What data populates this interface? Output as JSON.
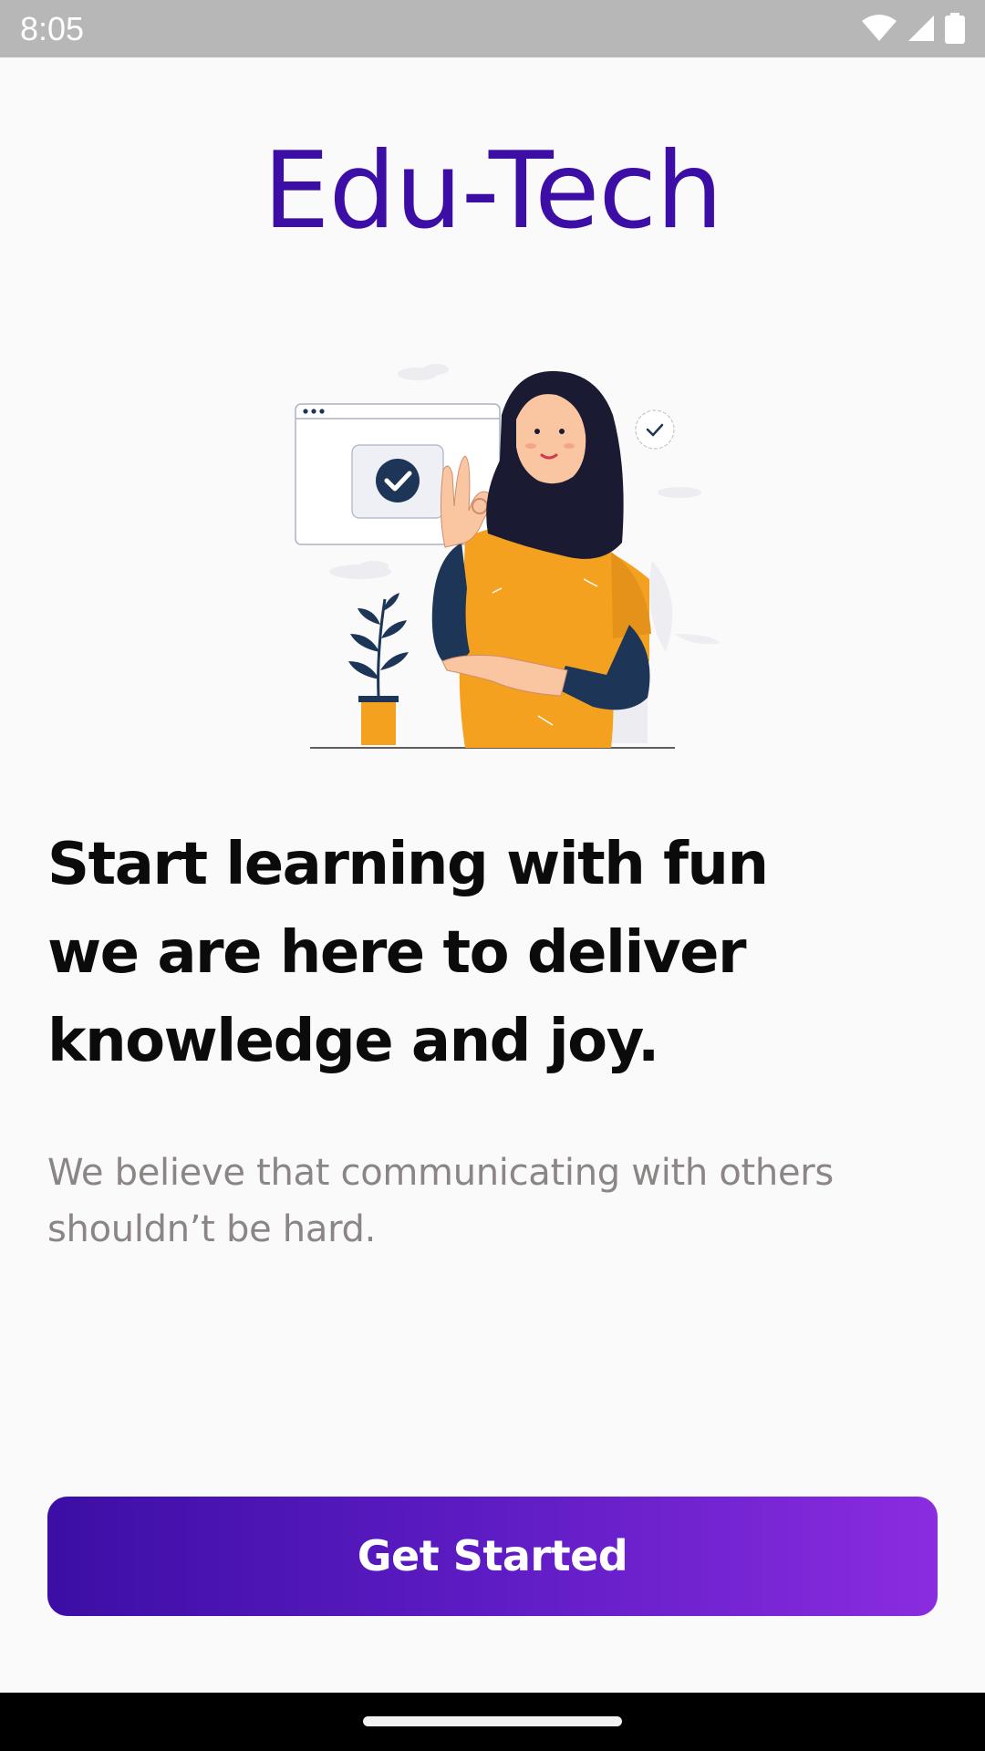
{
  "status_bar": {
    "time": "8:05",
    "icons": [
      "wifi-icon",
      "cell-signal-icon",
      "battery-icon"
    ]
  },
  "app": {
    "title": "Edu-Tech",
    "title_color": "#3d0ea6"
  },
  "illustration": {
    "name": "woman-ok-gesture-illustration"
  },
  "headline": {
    "lines": [
      "Start learning with fun",
      "we are here to deliver",
      "knowledge and joy."
    ]
  },
  "subtext": {
    "lines": [
      "We believe that communicating with others",
      "shouldn’t be hard."
    ]
  },
  "cta": {
    "label": "Get Started",
    "gradient_start": "#3c0ea5",
    "gradient_end": "#8a2ce0"
  }
}
